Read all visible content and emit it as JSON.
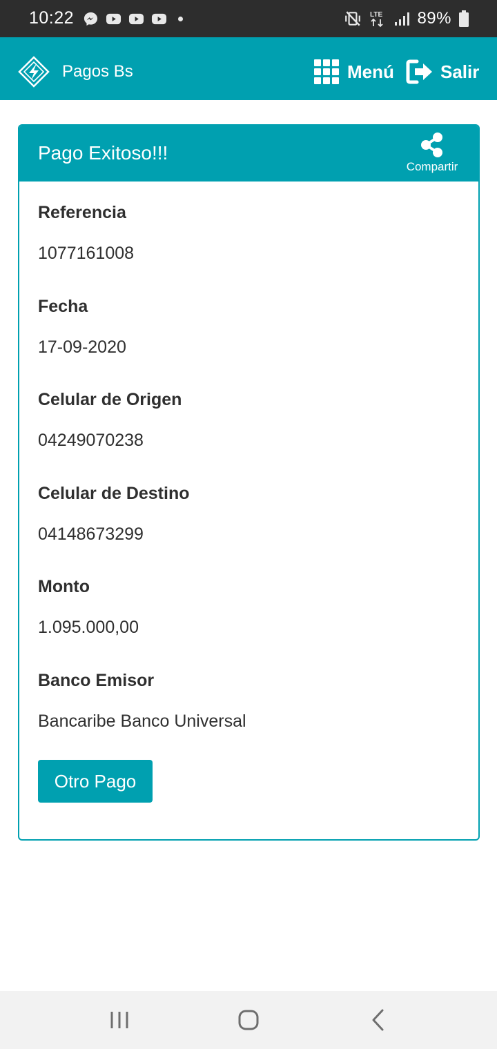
{
  "status_bar": {
    "time": "10:22",
    "battery": "89%",
    "network": "LTE",
    "notification_icons": [
      "messenger-icon",
      "youtube-icon",
      "youtube-icon",
      "youtube-icon",
      "more-dot-icon"
    ]
  },
  "app_bar": {
    "title": "Pagos Bs",
    "menu_label": "Menú",
    "logout_label": "Salir"
  },
  "card": {
    "title": "Pago Exitoso!!!",
    "share_label": "Compartir",
    "fields": [
      {
        "label": "Referencia",
        "value": "1077161008"
      },
      {
        "label": "Fecha",
        "value": "17-09-2020"
      },
      {
        "label": "Celular de Origen",
        "value": "04249070238"
      },
      {
        "label": "Celular de Destino",
        "value": "04148673299"
      },
      {
        "label": "Monto",
        "value": "1.095.000,00"
      },
      {
        "label": "Banco Emisor",
        "value": "Bancaribe Banco Universal"
      }
    ],
    "action_label": "Otro Pago"
  },
  "colors": {
    "primary": "#00a0b0",
    "status_bar": "#2d2d2d",
    "nav_bar": "#f2f2f2",
    "text": "#2f2f2f"
  }
}
